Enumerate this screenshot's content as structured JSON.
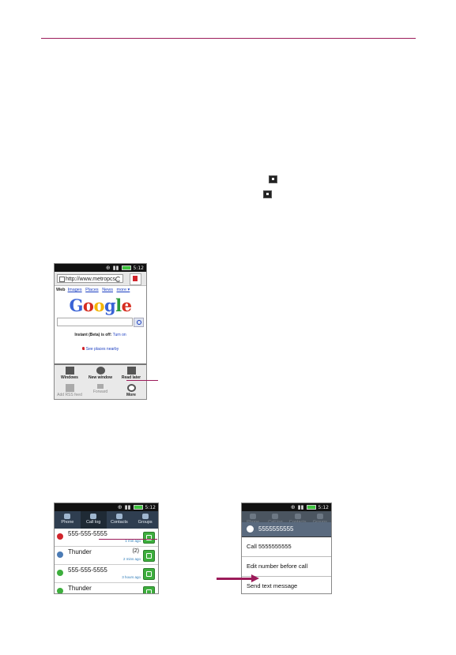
{
  "browser": {
    "status_time": "5:12",
    "url": "http://www.metropcs...",
    "nav_tabs": [
      "Web",
      "Images",
      "Places",
      "News",
      "more ▾"
    ],
    "logo_text": [
      "G",
      "o",
      "o",
      "g",
      "l",
      "e"
    ],
    "logo_colors": [
      "#3a63d6",
      "#d62d20",
      "#f4b400",
      "#3a63d6",
      "#2a9a3a",
      "#d62d20"
    ],
    "instant_text": "Instant (Beta) is off:",
    "instant_link": "Turn on",
    "places_link": "See places nearby",
    "menu": {
      "windows": "Windows",
      "new_window": "New window",
      "read_later": "Read later",
      "add_rss": "Add RSS feed",
      "forward": "Forward",
      "more": "More"
    }
  },
  "call_log": {
    "status_time": "5:12",
    "tabs": [
      "Phone",
      "Call log",
      "Contacts",
      "Groups"
    ],
    "rows": [
      {
        "name": "555-555-5555",
        "count": "",
        "time": "1 min ago",
        "icon_color": "#d0242b"
      },
      {
        "name": "Thunder",
        "count": "(2)",
        "time": "2 mins ago",
        "icon_color": "#4b7bb5"
      },
      {
        "name": "555-555-5555",
        "count": "",
        "time": "3 hours ago",
        "icon_color": "#3dae3d"
      },
      {
        "name": "Thunder",
        "count": "",
        "time": "4 hours ago",
        "icon_color": "#3dae3d"
      }
    ]
  },
  "context_menu": {
    "status_time": "5:12",
    "tabs": [
      "Phone",
      "Call log",
      "Contacts",
      "Groups"
    ],
    "header": "5555555555",
    "items": [
      "Call 5555555555",
      "Edit number before call",
      "Send text message"
    ]
  },
  "colors": {
    "accent": "#9c1b5a"
  }
}
